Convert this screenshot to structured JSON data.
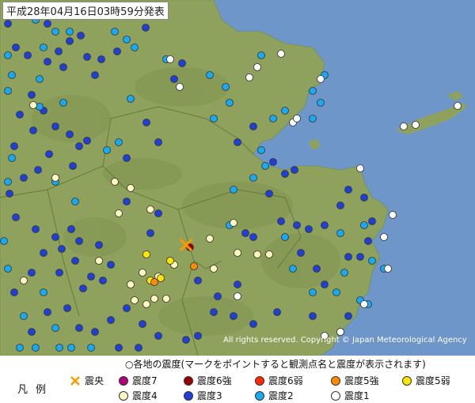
{
  "title": "平成28年04月16日03時59分発表",
  "copyright": "All rights reserved. Copyright © Japan Meteorological Agency",
  "legend": {
    "label": "凡例",
    "note": "○各地の震度(マークをポイントすると観測点名と震度が表示されます)",
    "epicenter": "震央",
    "items": [
      {
        "label": "震度7",
        "color": "#b0007b"
      },
      {
        "label": "震度6強",
        "color": "#9c0000"
      },
      {
        "label": "震度6弱",
        "color": "#ff2a00"
      },
      {
        "label": "震度5強",
        "color": "#ff8c00"
      },
      {
        "label": "震度5弱",
        "color": "#ffe600"
      },
      {
        "label": "震度4",
        "color": "#fff7c0"
      },
      {
        "label": "震度3",
        "color": "#1f3fd6"
      },
      {
        "label": "震度2",
        "color": "#19a9f2"
      },
      {
        "label": "震度1",
        "color": "#ffffff"
      }
    ]
  },
  "colors": {
    "sea": "#6f96c8",
    "land": "#8fa65a",
    "epicenter": "#ff9900"
  }
}
